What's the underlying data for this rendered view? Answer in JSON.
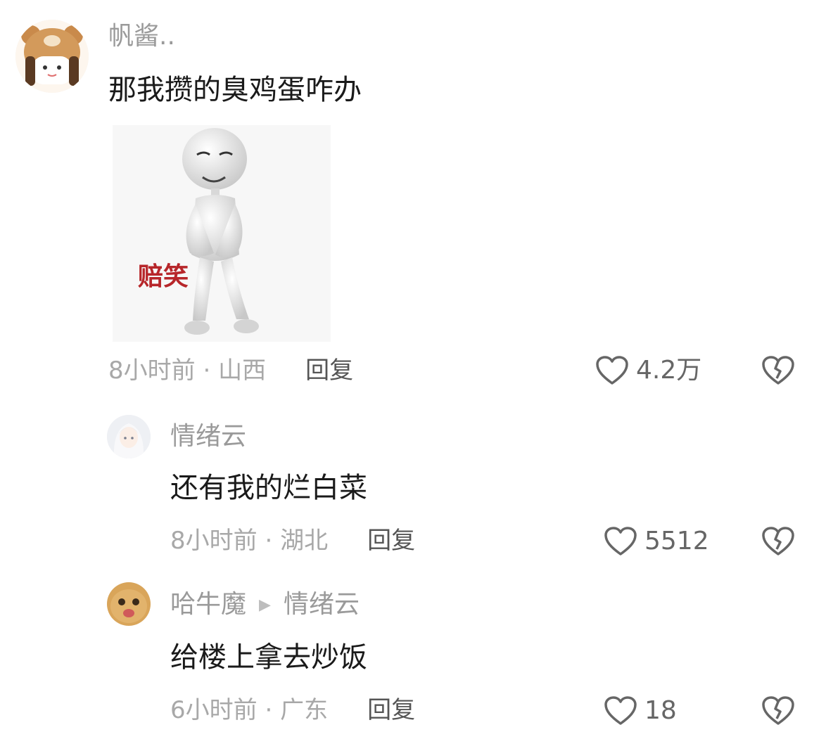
{
  "comments": [
    {
      "username": "帆酱..",
      "text": "那我攒的臭鸡蛋咋办",
      "sticker_caption": "赔笑",
      "time": "8小时前",
      "location": "山西",
      "reply_label": "回复",
      "likes": "4.2万"
    },
    {
      "username": "情绪云",
      "text": "还有我的烂白菜",
      "time": "8小时前",
      "location": "湖北",
      "reply_label": "回复",
      "likes": "5512"
    },
    {
      "username": "哈牛魔",
      "reply_to": "情绪云",
      "text": "给楼上拿去炒饭",
      "time": "6小时前",
      "location": "广东",
      "reply_label": "回复",
      "likes": "18"
    }
  ],
  "separator": " · "
}
